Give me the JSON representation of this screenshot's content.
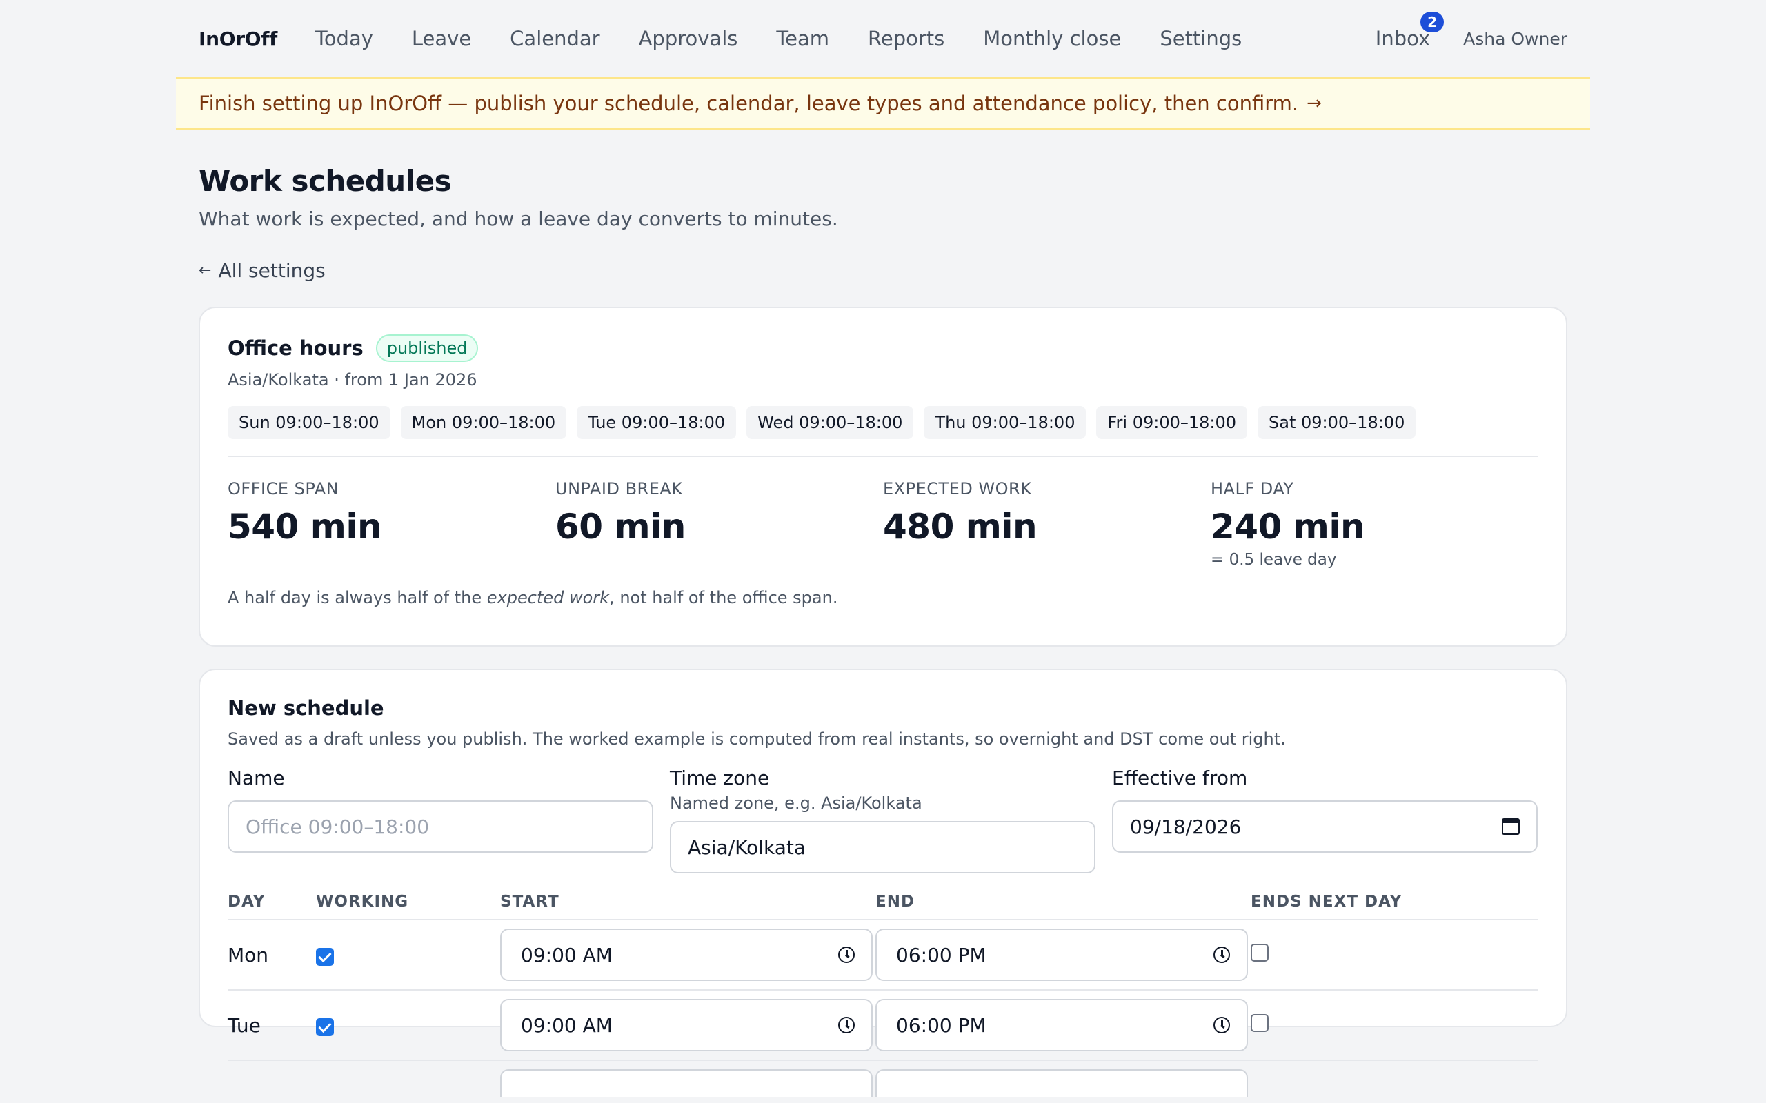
{
  "nav": {
    "brand": "InOrOff",
    "links": [
      "Today",
      "Leave",
      "Calendar",
      "Approvals",
      "Team",
      "Reports",
      "Monthly close",
      "Settings"
    ],
    "inbox_label": "Inbox",
    "inbox_count": "2",
    "user_name": "Asha Owner"
  },
  "banner": {
    "text": "Finish setting up InOrOff — publish your schedule, calendar, leave types and attendance policy, then confirm.",
    "arrow": "→"
  },
  "page": {
    "title": "Work schedules",
    "subtitle": "What work is expected, and how a leave day converts to minutes.",
    "back_arrow": "←",
    "back_label": "All settings"
  },
  "office_hours": {
    "title": "Office hours",
    "status": "published",
    "meta": "Asia/Kolkata · from 1 Jan 2026",
    "days": [
      "Sun 09:00–18:00",
      "Mon 09:00–18:00",
      "Tue 09:00–18:00",
      "Wed 09:00–18:00",
      "Thu 09:00–18:00",
      "Fri 09:00–18:00",
      "Sat 09:00–18:00"
    ],
    "stats": [
      {
        "label": "Office span",
        "value": "540 min",
        "note": ""
      },
      {
        "label": "Unpaid break",
        "value": "60 min",
        "note": ""
      },
      {
        "label": "Expected work",
        "value": "480 min",
        "note": ""
      },
      {
        "label": "Half day",
        "value": "240 min",
        "note": "= 0.5 leave day"
      }
    ],
    "footnote_before": "A half day is always half of the ",
    "footnote_em": "expected work",
    "footnote_after": ", not half of the office span."
  },
  "new_schedule": {
    "title": "New schedule",
    "description": "Saved as a draft unless you publish. The worked example is computed from real instants, so overnight and DST come out right.",
    "name_label": "Name",
    "name_placeholder": "Office 09:00–18:00",
    "tz_label": "Time zone",
    "tz_hint": "Named zone, e.g. Asia/Kolkata",
    "tz_value": "Asia/Kolkata",
    "effective_label": "Effective from",
    "effective_value": "09/18/2026",
    "columns": [
      "DAY",
      "WORKING",
      "START",
      "END",
      "ENDS NEXT DAY"
    ],
    "rows": [
      {
        "day": "Mon",
        "working": true,
        "start": "09:00 AM",
        "end": "06:00 PM",
        "next_day": false
      },
      {
        "day": "Tue",
        "working": true,
        "start": "09:00 AM",
        "end": "06:00 PM",
        "next_day": false
      }
    ]
  }
}
